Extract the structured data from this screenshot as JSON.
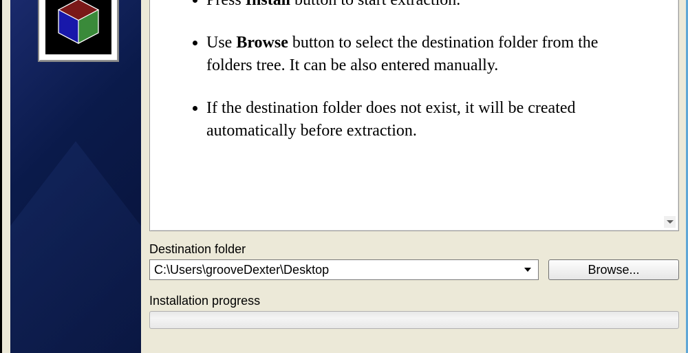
{
  "instructions": {
    "item1_pre": "Press ",
    "item1_bold": "Install",
    "item1_post": " button to start extraction.",
    "item2_pre": "Use ",
    "item2_bold": "Browse",
    "item2_post": " button to select the destination folder from the folders tree. It can be also entered manually.",
    "item3": "If the destination folder does not exist, it will be created automatically before extraction."
  },
  "destination": {
    "label": "Destination folder",
    "value": "C:\\Users\\grooveDexter\\Desktop",
    "browse_label": "Browse..."
  },
  "progress": {
    "label": "Installation progress"
  }
}
